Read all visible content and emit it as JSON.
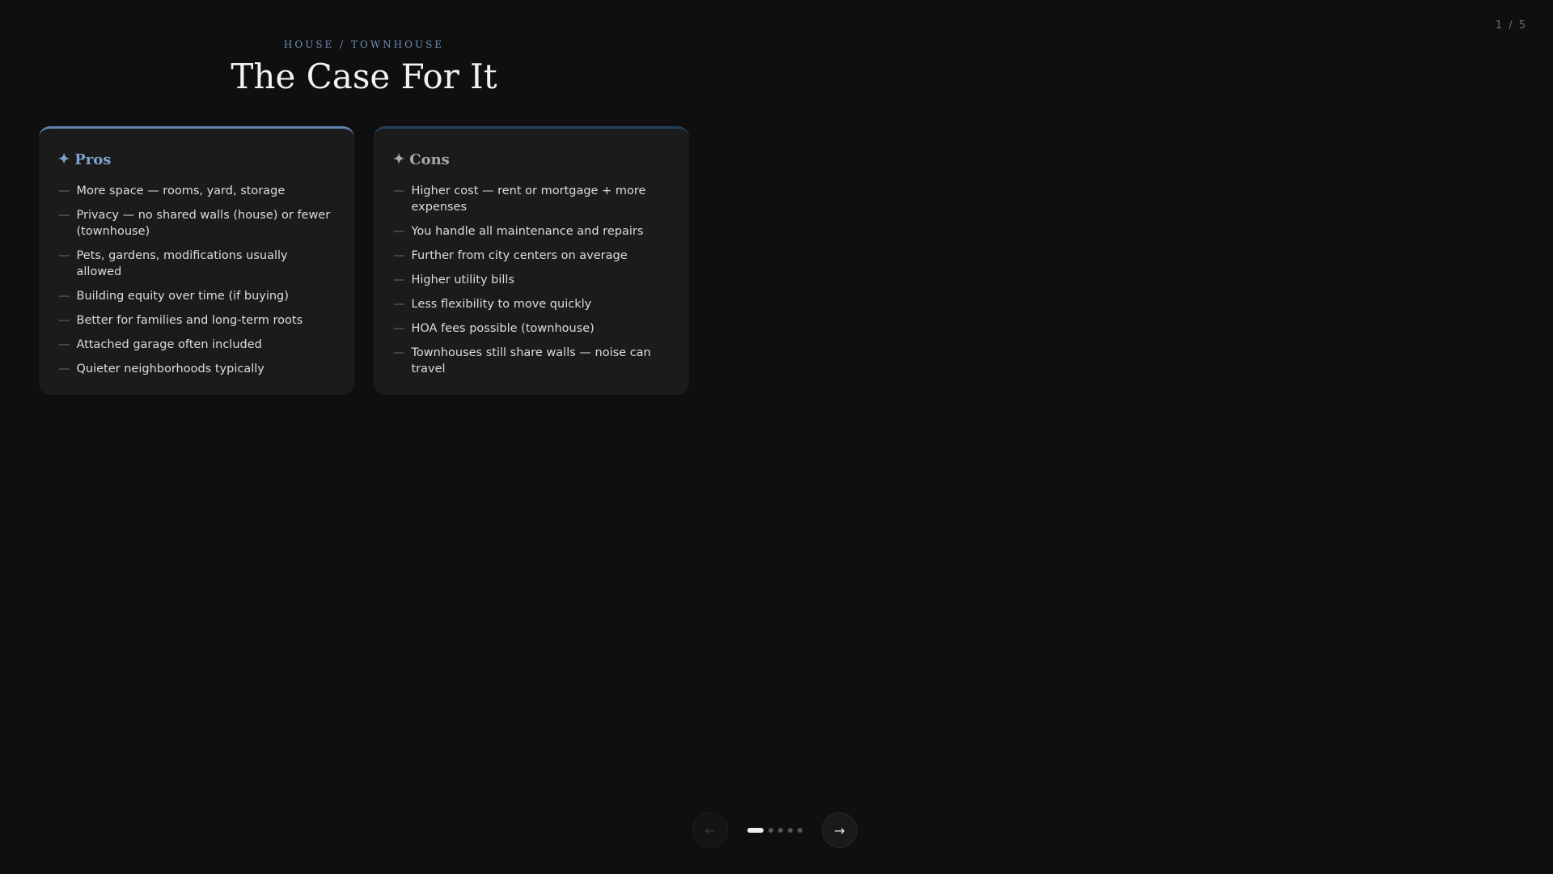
{
  "counter": "1 / 5",
  "header": {
    "eyebrow": "HOUSE / TOWNHOUSE",
    "title": "The Case For It"
  },
  "pros": {
    "icon": "✦",
    "label": "Pros",
    "items": [
      "More space — rooms, yard, storage",
      "Privacy — no shared walls (house) or fewer (townhouse)",
      "Pets, gardens, modifications usually allowed",
      "Building equity over time (if buying)",
      "Better for families and long-term roots",
      "Attached garage often included",
      "Quieter neighborhoods typically"
    ]
  },
  "cons": {
    "icon": "✦",
    "label": "Cons",
    "items": [
      "Higher cost — rent or mortgage + more expenses",
      "You handle all maintenance and repairs",
      "Further from city centers on average",
      "Higher utility bills",
      "Less flexibility to move quickly",
      "HOA fees possible (townhouse)",
      "Townhouses still share walls — noise can travel"
    ]
  },
  "nav": {
    "prev": "←",
    "next": "→",
    "current_slide": 1,
    "total_slides": 5
  },
  "colors": {
    "background": "#0f0f0f",
    "card": "#1b1b1b",
    "accent": "#7ea3d2"
  }
}
